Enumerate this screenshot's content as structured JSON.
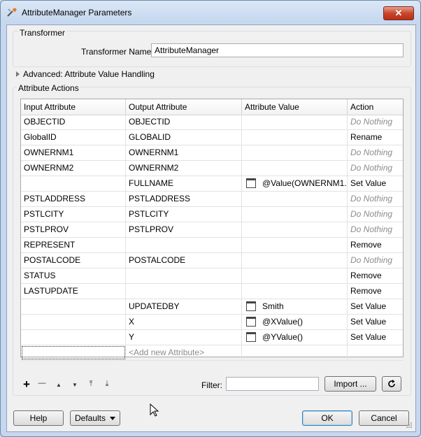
{
  "window": {
    "title": "AttributeManager Parameters",
    "close_label": "✕"
  },
  "transformer": {
    "group_label": "Transformer",
    "name_label": "Transformer Name:",
    "name_value": "AttributeManager"
  },
  "advanced": {
    "label": "Advanced: Attribute Value Handling"
  },
  "actions": {
    "group_label": "Attribute Actions",
    "columns": [
      "Input Attribute",
      "Output Attribute",
      "Attribute Value",
      "Action"
    ],
    "rows": [
      {
        "input": "OBJECTID",
        "output": "OBJECTID",
        "value": "",
        "action": "Do Nothing"
      },
      {
        "input": "GlobalID",
        "output": "GLOBALID",
        "value": "",
        "action": "Rename"
      },
      {
        "input": "OWNERNM1",
        "output": "OWNERNM1",
        "value": "",
        "action": "Do Nothing"
      },
      {
        "input": "OWNERNM2",
        "output": "OWNERNM2",
        "value": "",
        "action": "Do Nothing"
      },
      {
        "input": "",
        "output": "FULLNAME",
        "value": "@Value(OWNERNM1...",
        "action": "Set Value"
      },
      {
        "input": "PSTLADDRESS",
        "output": "PSTLADDRESS",
        "value": "",
        "action": "Do Nothing"
      },
      {
        "input": "PSTLCITY",
        "output": "PSTLCITY",
        "value": "",
        "action": "Do Nothing"
      },
      {
        "input": "PSTLPROV",
        "output": "PSTLPROV",
        "value": "",
        "action": "Do Nothing"
      },
      {
        "input": "REPRESENT",
        "output": "",
        "value": "",
        "action": "Remove"
      },
      {
        "input": "POSTALCODE",
        "output": "POSTALCODE",
        "value": "",
        "action": "Do Nothing"
      },
      {
        "input": "STATUS",
        "output": "",
        "value": "",
        "action": "Remove"
      },
      {
        "input": "LASTUPDATE",
        "output": "",
        "value": "",
        "action": "Remove"
      },
      {
        "input": "",
        "output": "UPDATEDBY",
        "value": "Smith",
        "action": "Set Value"
      },
      {
        "input": "",
        "output": "X",
        "value": "@XValue()",
        "action": "Set Value"
      },
      {
        "input": "",
        "output": "Y",
        "value": "@YValue()",
        "action": "Set Value"
      }
    ],
    "new_row_placeholder": "<Add new Attribute>"
  },
  "toolbar": {
    "add": "+",
    "remove": "—",
    "move_up": "▲",
    "move_down": "▼",
    "move_top": "⤒",
    "move_bottom": "⤓"
  },
  "filter": {
    "label": "Filter:",
    "value": ""
  },
  "buttons": {
    "import": "Import ...",
    "help": "Help",
    "defaults": "Defaults",
    "ok": "OK",
    "cancel": "Cancel"
  }
}
